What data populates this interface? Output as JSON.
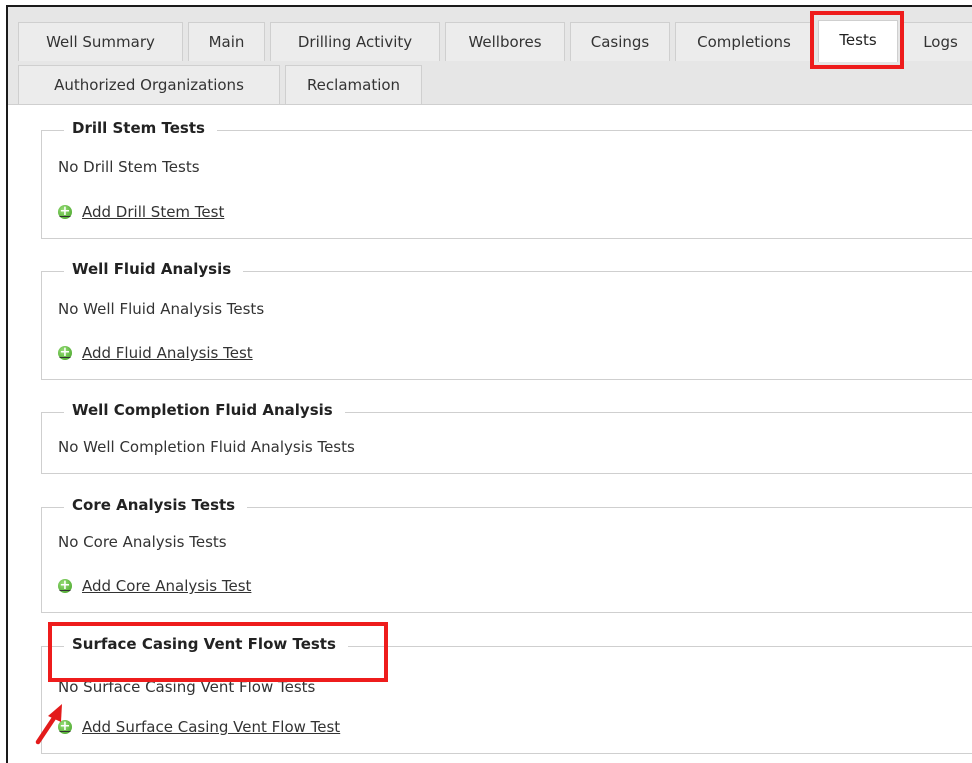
{
  "tabs_row1": [
    {
      "label": "Well Summary"
    },
    {
      "label": "Main"
    },
    {
      "label": "Drilling Activity"
    },
    {
      "label": "Wellbores"
    },
    {
      "label": "Casings"
    },
    {
      "label": "Completions"
    },
    {
      "label": "Tests"
    },
    {
      "label": "Logs"
    }
  ],
  "tabs_row2": [
    {
      "label": "Authorized Organizations"
    },
    {
      "label": "Reclamation"
    }
  ],
  "sections": [
    {
      "title": "Drill Stem Tests",
      "empty_text": "No Drill Stem Tests",
      "add_label": "Add Drill Stem Test"
    },
    {
      "title": "Well Fluid Analysis",
      "empty_text": "No Well Fluid Analysis Tests",
      "add_label": "Add Fluid Analysis Test"
    },
    {
      "title": "Well Completion Fluid Analysis",
      "empty_text": "No Well Completion Fluid Analysis Tests"
    },
    {
      "title": "Core Analysis Tests",
      "empty_text": "No Core Analysis Tests",
      "add_label": "Add Core Analysis Test"
    },
    {
      "title": "Surface Casing Vent Flow Tests",
      "empty_text": "No Surface Casing Vent Flow Tests",
      "add_label": "Add Surface Casing Vent Flow Test"
    }
  ],
  "colors": {
    "highlight": "#ee1c1c",
    "arrow": "#e31b1b",
    "plus_icon": "#4caf2a"
  },
  "icons": {
    "add": "plus-circle-icon",
    "pointer": "red-arrow-icon"
  }
}
